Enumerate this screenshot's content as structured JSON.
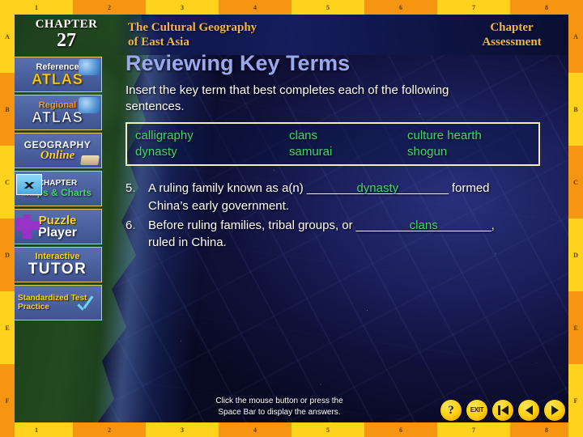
{
  "header": {
    "chapter_word": "CHAPTER",
    "chapter_number": "27",
    "book_title_line1": "The Cultural Geography",
    "book_title_line2": "of East Asia",
    "assessment_line1": "Chapter",
    "assessment_line2": "Assessment"
  },
  "sidebar": {
    "items": [
      {
        "name": "reference-atlas",
        "line1": "Reference",
        "line2": "ATLAS"
      },
      {
        "name": "regional-atlas",
        "line1": "Regional",
        "line2": "ATLAS"
      },
      {
        "name": "geography-online",
        "line1": "GEOGRAPHY",
        "line2": "Online"
      },
      {
        "name": "chapter-maps-charts",
        "line1": "CHAPTER",
        "line2": "Maps & Charts"
      },
      {
        "name": "puzzle-player",
        "line1": "Puzzle",
        "line2": "Player"
      },
      {
        "name": "interactive-tutor",
        "line1": "Interactive",
        "line2": "TUTOR"
      },
      {
        "name": "standardized-test-practice",
        "line1": "Standardized Test Practice",
        "line2": ""
      }
    ]
  },
  "main": {
    "title": "Reviewing Key Terms",
    "instructions": "Insert the key term that best completes each of the following sentences.",
    "terms": [
      [
        "calligraphy",
        "clans",
        "culture hearth"
      ],
      [
        "dynasty",
        "samurai",
        "shogun"
      ]
    ],
    "questions": [
      {
        "number": "5.",
        "text_before": "A ruling family known as a(n)",
        "blank_rule": "______________________",
        "answer": "dynasty",
        "text_after": " formed China’s early government."
      },
      {
        "number": "6.",
        "text_before": "Before ruling families, tribal groups, or",
        "blank_rule": "_____________________",
        "answer": "clans",
        "text_after": ", ruled in China."
      }
    ]
  },
  "footer": {
    "note_line1": "Click the mouse button or press the",
    "note_line2": "Space Bar to display the answers.",
    "nav_buttons": [
      {
        "name": "help-button",
        "glyph": "?",
        "style": "text"
      },
      {
        "name": "exit-button",
        "glyph": "EXIT",
        "style": "small"
      },
      {
        "name": "first-button",
        "glyph": "",
        "style": "first"
      },
      {
        "name": "previous-button",
        "glyph": "",
        "style": "prev"
      },
      {
        "name": "next-button",
        "glyph": "",
        "style": "next"
      }
    ]
  },
  "frame": {
    "columns": [
      "1",
      "2",
      "3",
      "4",
      "5",
      "6",
      "7",
      "8"
    ],
    "rows": [
      "A",
      "B",
      "C",
      "D",
      "E",
      "F"
    ]
  },
  "colors": {
    "frame_yellow": "#ffd21e",
    "frame_orange": "#f59512",
    "title_blue": "#9aa8f0",
    "answer_green": "#3fd86a",
    "header_gold": "#f0b846"
  }
}
